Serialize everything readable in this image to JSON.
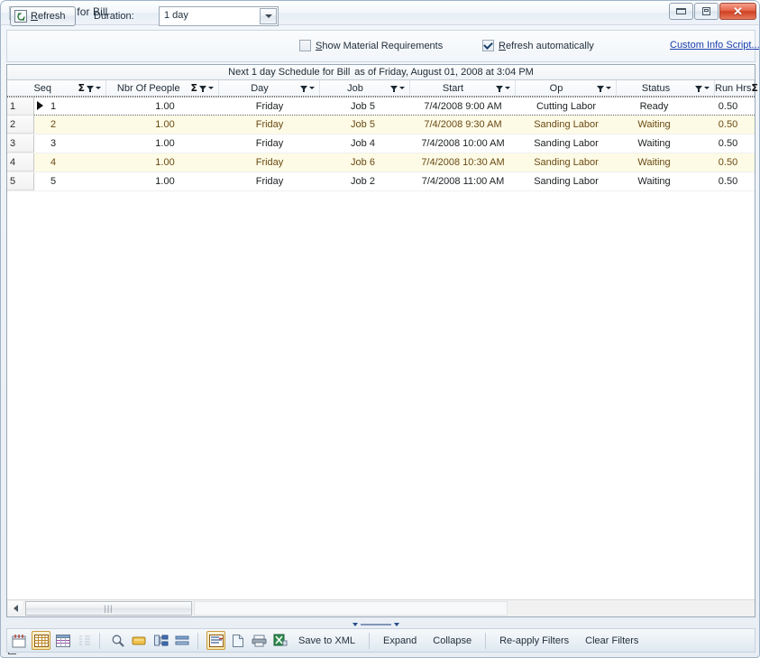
{
  "window": {
    "title": "Schedule for Bill",
    "icon": "app-window-icon",
    "buttons": {
      "minimize": "minimize-button",
      "maximize": "maximize-button",
      "close": "✕"
    }
  },
  "toolbar": {
    "refresh_label_pre": "",
    "refresh_accel": "R",
    "refresh_label_post": "efresh",
    "refresh_full": "Refresh",
    "duration_label": "Duration:",
    "duration_value": "1 day",
    "duration_options": [
      "1 day"
    ],
    "show_material_accel": "S",
    "show_material_rest": "how Material Requirements",
    "show_material_full": "Show Material Requirements",
    "show_material_checked": false,
    "refresh_auto_accel": "R",
    "refresh_auto_rest": "efresh automatically",
    "refresh_auto_full": "Refresh automatically",
    "refresh_auto_checked": true,
    "custom_info_link": "Custom Info Script...",
    "link_color": "#1b3fae"
  },
  "grid": {
    "caption_main": "Next 1 day Schedule for Bill",
    "caption_sub": "as of Friday, August 01, 2008 at 3:04 PM",
    "columns": [
      {
        "key": "seq",
        "label": "Seq",
        "sigma": true,
        "filter": true
      },
      {
        "key": "nbr",
        "label": "Nbr Of People",
        "sigma": true,
        "filter": true
      },
      {
        "key": "day",
        "label": "Day",
        "sigma": false,
        "filter": true
      },
      {
        "key": "job",
        "label": "Job",
        "sigma": false,
        "filter": true
      },
      {
        "key": "start",
        "label": "Start",
        "sigma": false,
        "filter": true
      },
      {
        "key": "op",
        "label": "Op",
        "sigma": false,
        "filter": true
      },
      {
        "key": "status",
        "label": "Status",
        "sigma": false,
        "filter": true
      },
      {
        "key": "runhrs",
        "label": "Run Hrs",
        "sigma": true,
        "filter": true
      }
    ],
    "rows": [
      {
        "n": "1",
        "seq": "1",
        "nbr": "1.00",
        "day": "Friday",
        "job": "Job 5",
        "start": "7/4/2008 9:00 AM",
        "op": "Cutting Labor",
        "status": "Ready",
        "runhrs": "0.50",
        "current": true,
        "alt": false
      },
      {
        "n": "2",
        "seq": "2",
        "nbr": "1.00",
        "day": "Friday",
        "job": "Job 5",
        "start": "7/4/2008 9:30 AM",
        "op": "Sanding Labor",
        "status": "Waiting",
        "runhrs": "0.50",
        "current": false,
        "alt": true
      },
      {
        "n": "3",
        "seq": "3",
        "nbr": "1.00",
        "day": "Friday",
        "job": "Job 4",
        "start": "7/4/2008 10:00 AM",
        "op": "Sanding Labor",
        "status": "Waiting",
        "runhrs": "0.50",
        "current": false,
        "alt": false
      },
      {
        "n": "4",
        "seq": "4",
        "nbr": "1.00",
        "day": "Friday",
        "job": "Job 6",
        "start": "7/4/2008 10:30 AM",
        "op": "Sanding Labor",
        "status": "Waiting",
        "runhrs": "0.50",
        "current": false,
        "alt": true
      },
      {
        "n": "5",
        "seq": "5",
        "nbr": "1.00",
        "day": "Friday",
        "job": "Job 2",
        "start": "7/4/2008 11:00 AM",
        "op": "Sanding Labor",
        "status": "Waiting",
        "runhrs": "0.50",
        "current": false,
        "alt": false
      }
    ],
    "alt_row_bg": "#fdfbe6",
    "alt_row_text_color": "#6b4a13"
  },
  "bottom_toolbar": {
    "icons": [
      "card-view-icon",
      "grid-view-icon",
      "group-view-icon",
      "list-view-icon",
      "find-icon",
      "card-icon",
      "hierarchy-icon",
      "summary-icon",
      "print-preview-icon",
      "copy-icon",
      "print-icon",
      "export-excel-icon"
    ],
    "buttons": [
      "Save to XML",
      "Expand",
      "Collapse",
      "Re-apply Filters",
      "Clear Filters"
    ]
  }
}
